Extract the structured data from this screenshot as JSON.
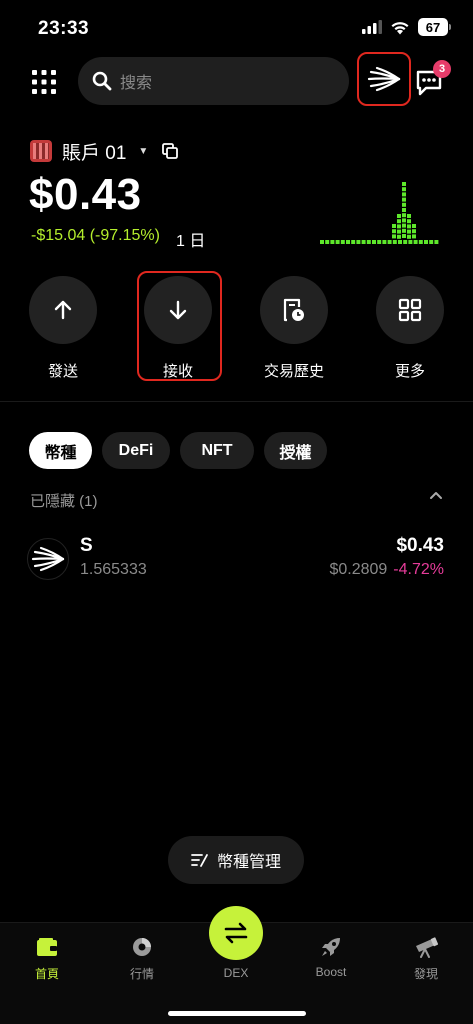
{
  "status": {
    "time": "23:33",
    "battery": "67"
  },
  "search": {
    "placeholder": "搜索"
  },
  "messages": {
    "badge_count": "3"
  },
  "account": {
    "name": "賬戶 01"
  },
  "balance": {
    "value": "$0.43",
    "pnl": "-$15.04 (-97.15%)",
    "period": "1 日"
  },
  "actions": [
    {
      "label": "發送",
      "icon": "arrow-up-icon"
    },
    {
      "label": "接收",
      "icon": "arrow-down-icon"
    },
    {
      "label": "交易歷史",
      "icon": "history-icon"
    },
    {
      "label": "更多",
      "icon": "grid-icon"
    }
  ],
  "tabs": [
    {
      "label": "幣種",
      "active": true
    },
    {
      "label": "DeFi",
      "active": false
    },
    {
      "label": "NFT",
      "active": false
    },
    {
      "label": "授權",
      "active": false
    }
  ],
  "hidden": {
    "label": "已隱藏 (1)"
  },
  "tokens": [
    {
      "symbol": "S",
      "amount": "1.565333",
      "value": "$0.43",
      "price": "$0.2809",
      "change": "-4.72%"
    }
  ],
  "manage": {
    "label": "幣種管理"
  },
  "nav": [
    {
      "label": "首頁",
      "icon": "wallet-icon",
      "active": true
    },
    {
      "label": "行情",
      "icon": "market-icon",
      "active": false
    },
    {
      "label": "DEX",
      "icon": "swap-icon",
      "active": false
    },
    {
      "label": "Boost",
      "icon": "rocket-icon",
      "active": false
    },
    {
      "label": "發現",
      "icon": "telescope-icon",
      "active": false
    }
  ],
  "colors": {
    "accent": "#c6f23a",
    "positive_text": "#b5ef2d",
    "negative_change": "#e63c9a",
    "highlight_border": "#e0281f"
  }
}
